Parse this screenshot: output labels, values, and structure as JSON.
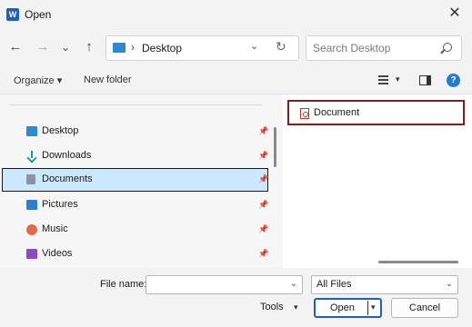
{
  "window": {
    "title": "Open",
    "app_icon_letter": "W",
    "close_glyph": "✕"
  },
  "nav": {
    "back_glyph": "←",
    "forward_glyph": "→",
    "recent_glyph": "⌄",
    "up_glyph": "↑"
  },
  "address": {
    "separator": "›",
    "location": "Desktop",
    "dropdown_glyph": "⌄",
    "refresh_glyph": "↻"
  },
  "search": {
    "placeholder": "Search Desktop"
  },
  "toolbar": {
    "organize": "Organize ▾",
    "new_folder": "New folder",
    "view_dropdown_glyph": "▾",
    "help_glyph": "?"
  },
  "sidebar": {
    "items": [
      {
        "label": "Desktop",
        "icon": "desktop-icon",
        "pinned": true
      },
      {
        "label": "Downloads",
        "icon": "download-icon",
        "pinned": true
      },
      {
        "label": "Documents",
        "icon": "documents-icon",
        "pinned": true,
        "selected": true
      },
      {
        "label": "Pictures",
        "icon": "pictures-icon",
        "pinned": true
      },
      {
        "label": "Music",
        "icon": "music-icon",
        "pinned": true
      },
      {
        "label": "Videos",
        "icon": "videos-icon",
        "pinned": true
      }
    ],
    "pin_glyph": "📌"
  },
  "files": [
    {
      "label": "Document",
      "icon": "pdf-file-icon",
      "highlighted": true
    }
  ],
  "footer": {
    "file_name_label": "File name:",
    "file_name_value": "",
    "dropdown_glyph": "⌄",
    "file_type": "All Files",
    "tools": "Tools",
    "tools_dropdown_glyph": "▾",
    "open": "Open",
    "open_dropdown_glyph": "▾",
    "cancel": "Cancel"
  },
  "colors": {
    "accent": "#1f5fbf",
    "selection": "#cce8ff",
    "highlight_border": "#8b1a1a"
  }
}
